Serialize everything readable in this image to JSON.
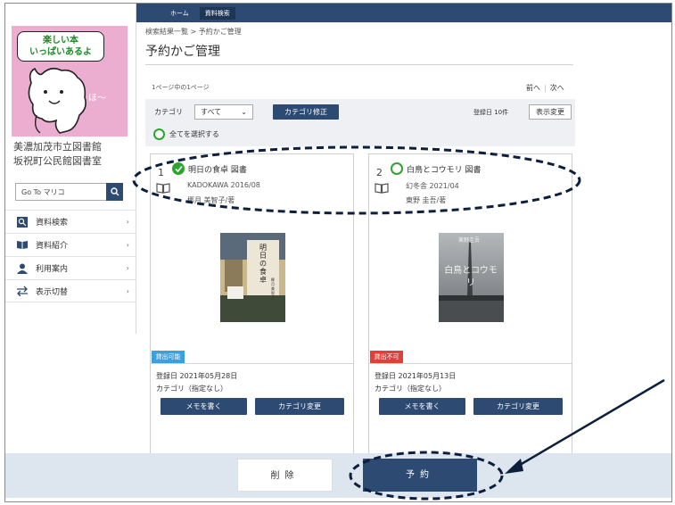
{
  "topbar": {
    "nav": [
      "ホーム",
      "資料検索"
    ],
    "bg_color": "#2c4a72"
  },
  "sidebar": {
    "mascot_bubble_line1": "楽しい本",
    "mascot_bubble_line2": "いっぱいあるよ",
    "mascot_say": "ほ～",
    "library_name_line1": "美濃加茂市立図書館",
    "library_name_line2": "坂祝町公民館図書室",
    "search_value": "Go To マリコ",
    "menu": [
      {
        "label": "資料検索",
        "icon": "search-icon"
      },
      {
        "label": "資料紹介",
        "icon": "book-icon"
      },
      {
        "label": "利用案内",
        "icon": "user-icon"
      },
      {
        "label": "表示切替",
        "icon": "switch-arrows-icon"
      }
    ]
  },
  "main": {
    "breadcrumb": "検索結果一覧 > 予約かご管理",
    "title": "予約かご管理",
    "page_info": "1ページ中の1ページ",
    "prev": "前へ",
    "next": "次へ",
    "category_label": "カテゴリ",
    "category_value": "すべて",
    "category_edit": "カテゴリ修正",
    "order_label": "登録日 10件",
    "display_change": "表示変更",
    "select_all": "全てを選択する"
  },
  "cards": [
    {
      "num": "1",
      "title": "明日の食卓 図書",
      "publisher": "KADOKAWA 2016/08",
      "author": "椰月 美智子/著",
      "checked": true,
      "status": "貸出可能",
      "status_color": "#3ba0e0",
      "registered": "登録日 2021年05月28日",
      "category": "カテゴリ（指定なし）",
      "memo_btn": "メモを書く",
      "cat_btn": "カテゴリ変更",
      "cover_text": "明日の食卓",
      "cover_author": "椰月美智子"
    },
    {
      "num": "2",
      "title": "白鳥とコウモリ 図書",
      "publisher": "幻冬舎 2021/04",
      "author": "東野 圭吾/著",
      "checked": false,
      "status": "貸出不可",
      "status_color": "#e0403a",
      "registered": "登録日 2021年05月13日",
      "category": "カテゴリ（指定なし）",
      "memo_btn": "メモを書く",
      "cat_btn": "カテゴリ変更",
      "cover_text": "白鳥とコウモリ",
      "cover_author": "東野圭吾"
    }
  ],
  "actions": {
    "delete": "削除",
    "reserve": "予約"
  }
}
